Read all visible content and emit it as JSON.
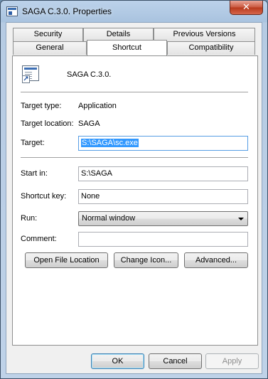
{
  "window": {
    "title": "SAGA C.3.0. Properties",
    "close_glyph": "✕",
    "app_icon": "shortcut-properties-icon"
  },
  "tabs": {
    "row1": [
      "Security",
      "Details",
      "Previous Versions"
    ],
    "row2": [
      "General",
      "Shortcut",
      "Compatibility"
    ],
    "active": "Shortcut"
  },
  "shortcut": {
    "name": "SAGA C.3.0.",
    "icon": "application-shortcut-icon",
    "target_type_label": "Target type:",
    "target_type_value": "Application",
    "target_location_label": "Target location:",
    "target_location_value": "SAGA",
    "target_label": "Target:",
    "target_value": "S:\\SAGA\\sc.exe",
    "start_in_label": "Start in:",
    "start_in_value": "S:\\SAGA",
    "shortcut_key_label": "Shortcut key:",
    "shortcut_key_value": "None",
    "run_label": "Run:",
    "run_value": "Normal window",
    "comment_label": "Comment:",
    "comment_value": "",
    "open_location_btn": "Open File Location",
    "change_icon_btn": "Change Icon...",
    "advanced_btn": "Advanced..."
  },
  "footer": {
    "ok": "OK",
    "cancel": "Cancel",
    "apply": "Apply"
  }
}
